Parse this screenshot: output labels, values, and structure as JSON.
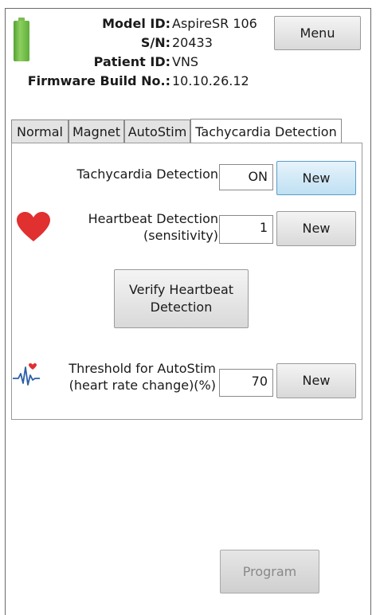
{
  "device": {
    "model_id_label": "Model ID:",
    "model_id_value": "AspireSR 106",
    "sn_label": "S/N:",
    "sn_value": "20433",
    "patient_id_label": "Patient ID:",
    "patient_id_value": "VNS",
    "firmware_label": "Firmware Build No.:",
    "firmware_value": "10.10.26.12",
    "battery_level": 1.0
  },
  "header": {
    "menu_label": "Menu"
  },
  "tabs": [
    {
      "label": "Normal"
    },
    {
      "label": "Magnet"
    },
    {
      "label": "AutoStim"
    },
    {
      "label": "Tachycardia Detection",
      "selected": true
    }
  ],
  "tachycardia_detection": {
    "label": "Tachycardia Detection",
    "value": "ON",
    "new_label": "New"
  },
  "heartbeat_detection": {
    "label_line1": "Heartbeat Detection",
    "label_line2": "(sensitivity)",
    "value": "1",
    "new_label": "New",
    "icon": "heart-icon"
  },
  "verify": {
    "label_line1": "Verify Heartbeat",
    "label_line2": "Detection"
  },
  "threshold": {
    "label_line1": "Threshold for AutoStim",
    "label_line2": "(heart rate change)(%)",
    "value": "70",
    "new_label": "New",
    "icon": "heart-rate-icon"
  },
  "footer": {
    "program_label": "Program"
  },
  "colors": {
    "heart": "#e03030",
    "battery": "#6ab845",
    "active_button": "#cfe8f6"
  }
}
